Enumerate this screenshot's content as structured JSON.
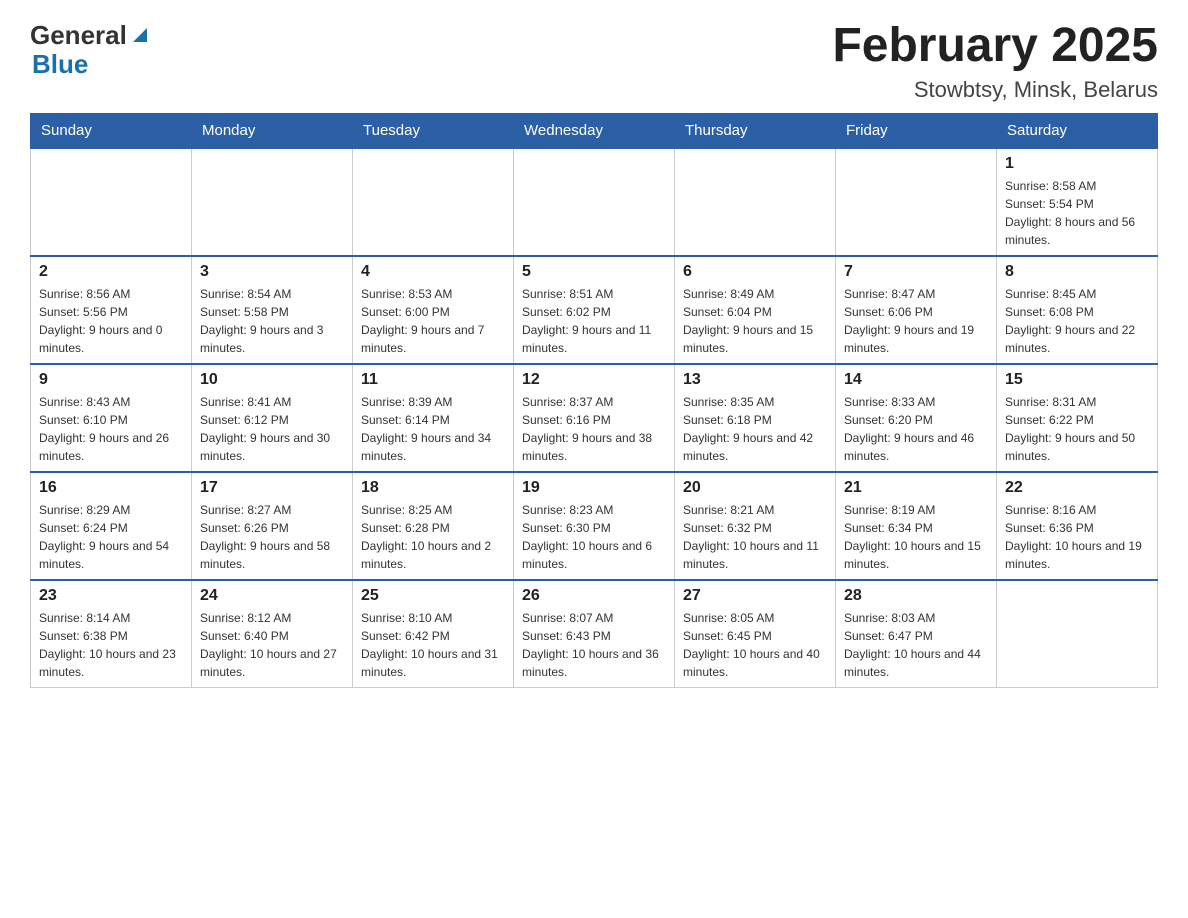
{
  "header": {
    "logo": {
      "text_general": "General",
      "text_blue": "Blue",
      "alt": "GeneralBlue logo"
    },
    "title": "February 2025",
    "location": "Stowbtsy, Minsk, Belarus"
  },
  "days_of_week": [
    "Sunday",
    "Monday",
    "Tuesday",
    "Wednesday",
    "Thursday",
    "Friday",
    "Saturday"
  ],
  "weeks": [
    [
      {
        "day": "",
        "info": ""
      },
      {
        "day": "",
        "info": ""
      },
      {
        "day": "",
        "info": ""
      },
      {
        "day": "",
        "info": ""
      },
      {
        "day": "",
        "info": ""
      },
      {
        "day": "",
        "info": ""
      },
      {
        "day": "1",
        "info": "Sunrise: 8:58 AM\nSunset: 5:54 PM\nDaylight: 8 hours and 56 minutes."
      }
    ],
    [
      {
        "day": "2",
        "info": "Sunrise: 8:56 AM\nSunset: 5:56 PM\nDaylight: 9 hours and 0 minutes."
      },
      {
        "day": "3",
        "info": "Sunrise: 8:54 AM\nSunset: 5:58 PM\nDaylight: 9 hours and 3 minutes."
      },
      {
        "day": "4",
        "info": "Sunrise: 8:53 AM\nSunset: 6:00 PM\nDaylight: 9 hours and 7 minutes."
      },
      {
        "day": "5",
        "info": "Sunrise: 8:51 AM\nSunset: 6:02 PM\nDaylight: 9 hours and 11 minutes."
      },
      {
        "day": "6",
        "info": "Sunrise: 8:49 AM\nSunset: 6:04 PM\nDaylight: 9 hours and 15 minutes."
      },
      {
        "day": "7",
        "info": "Sunrise: 8:47 AM\nSunset: 6:06 PM\nDaylight: 9 hours and 19 minutes."
      },
      {
        "day": "8",
        "info": "Sunrise: 8:45 AM\nSunset: 6:08 PM\nDaylight: 9 hours and 22 minutes."
      }
    ],
    [
      {
        "day": "9",
        "info": "Sunrise: 8:43 AM\nSunset: 6:10 PM\nDaylight: 9 hours and 26 minutes."
      },
      {
        "day": "10",
        "info": "Sunrise: 8:41 AM\nSunset: 6:12 PM\nDaylight: 9 hours and 30 minutes."
      },
      {
        "day": "11",
        "info": "Sunrise: 8:39 AM\nSunset: 6:14 PM\nDaylight: 9 hours and 34 minutes."
      },
      {
        "day": "12",
        "info": "Sunrise: 8:37 AM\nSunset: 6:16 PM\nDaylight: 9 hours and 38 minutes."
      },
      {
        "day": "13",
        "info": "Sunrise: 8:35 AM\nSunset: 6:18 PM\nDaylight: 9 hours and 42 minutes."
      },
      {
        "day": "14",
        "info": "Sunrise: 8:33 AM\nSunset: 6:20 PM\nDaylight: 9 hours and 46 minutes."
      },
      {
        "day": "15",
        "info": "Sunrise: 8:31 AM\nSunset: 6:22 PM\nDaylight: 9 hours and 50 minutes."
      }
    ],
    [
      {
        "day": "16",
        "info": "Sunrise: 8:29 AM\nSunset: 6:24 PM\nDaylight: 9 hours and 54 minutes."
      },
      {
        "day": "17",
        "info": "Sunrise: 8:27 AM\nSunset: 6:26 PM\nDaylight: 9 hours and 58 minutes."
      },
      {
        "day": "18",
        "info": "Sunrise: 8:25 AM\nSunset: 6:28 PM\nDaylight: 10 hours and 2 minutes."
      },
      {
        "day": "19",
        "info": "Sunrise: 8:23 AM\nSunset: 6:30 PM\nDaylight: 10 hours and 6 minutes."
      },
      {
        "day": "20",
        "info": "Sunrise: 8:21 AM\nSunset: 6:32 PM\nDaylight: 10 hours and 11 minutes."
      },
      {
        "day": "21",
        "info": "Sunrise: 8:19 AM\nSunset: 6:34 PM\nDaylight: 10 hours and 15 minutes."
      },
      {
        "day": "22",
        "info": "Sunrise: 8:16 AM\nSunset: 6:36 PM\nDaylight: 10 hours and 19 minutes."
      }
    ],
    [
      {
        "day": "23",
        "info": "Sunrise: 8:14 AM\nSunset: 6:38 PM\nDaylight: 10 hours and 23 minutes."
      },
      {
        "day": "24",
        "info": "Sunrise: 8:12 AM\nSunset: 6:40 PM\nDaylight: 10 hours and 27 minutes."
      },
      {
        "day": "25",
        "info": "Sunrise: 8:10 AM\nSunset: 6:42 PM\nDaylight: 10 hours and 31 minutes."
      },
      {
        "day": "26",
        "info": "Sunrise: 8:07 AM\nSunset: 6:43 PM\nDaylight: 10 hours and 36 minutes."
      },
      {
        "day": "27",
        "info": "Sunrise: 8:05 AM\nSunset: 6:45 PM\nDaylight: 10 hours and 40 minutes."
      },
      {
        "day": "28",
        "info": "Sunrise: 8:03 AM\nSunset: 6:47 PM\nDaylight: 10 hours and 44 minutes."
      },
      {
        "day": "",
        "info": ""
      }
    ]
  ]
}
